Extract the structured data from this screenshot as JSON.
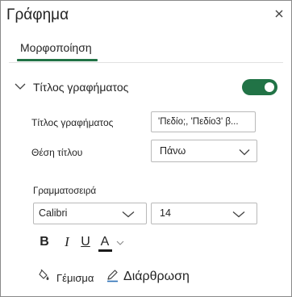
{
  "pane": {
    "title": "Γράφημα",
    "close_icon": "close-icon"
  },
  "tabs": [
    {
      "label": "Μορφοποίηση",
      "selected": true
    }
  ],
  "chart_title_section": {
    "label": "Τίτλος γραφήματος",
    "expanded": true,
    "toggle_on": true,
    "title_field": {
      "label": "Τίτλος γραφήματος",
      "value": "'Πεδίο;, 'Πεδίο3' β..."
    },
    "position_field": {
      "label": "Θέση τίτλου",
      "value": "Πάνω"
    }
  },
  "font": {
    "label": "Γραμματοσειρά",
    "family": "Calibri",
    "size": "14",
    "bold_label": "B",
    "italic_label": "I",
    "underline_label": "U",
    "color_label": "A",
    "color": "#1b1b1b"
  },
  "actions": {
    "fill_label": "Γέμισμα",
    "fill_icon": "paint-bucket-icon",
    "outline_label": "Διάρθρωση",
    "outline_icon": "pen-icon"
  },
  "colors": {
    "accent": "#217346"
  }
}
